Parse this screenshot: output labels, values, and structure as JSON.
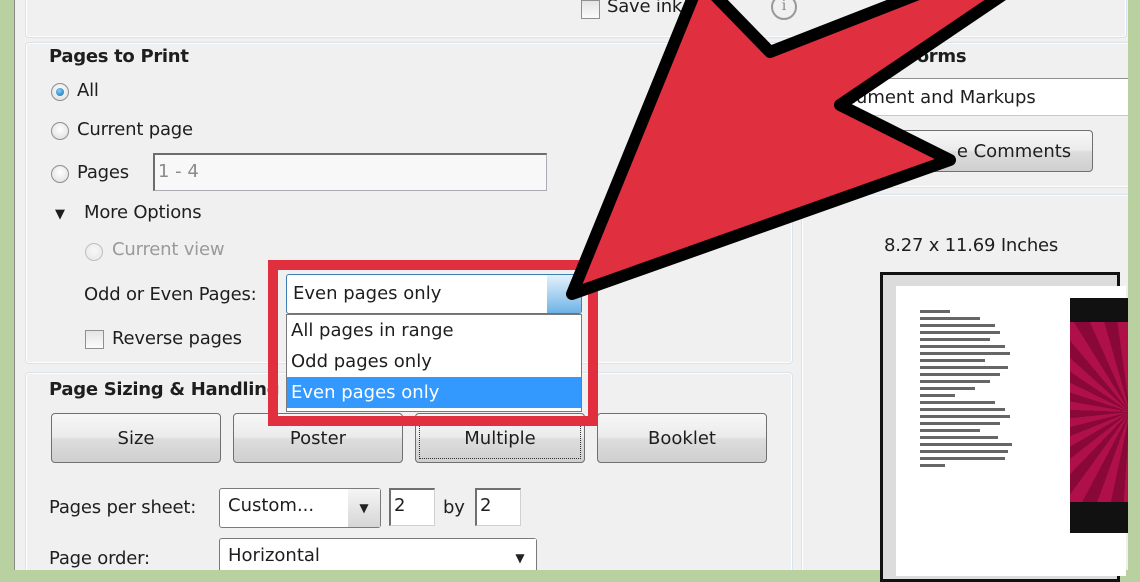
{
  "top": {
    "save_ink_label": "Save ink",
    "save_ink_checked": false,
    "info_icon": "info-icon"
  },
  "pages_to_print": {
    "title": "Pages to Print",
    "options": [
      {
        "label": "All",
        "selected": true
      },
      {
        "label": "Current page",
        "selected": false
      },
      {
        "label": "Pages",
        "selected": false
      }
    ],
    "pages_range_value": "1 - 4",
    "more_options_label": "More Options",
    "current_view_label": "Current view",
    "odd_even_label": "Odd or Even Pages:",
    "odd_even_selected": "Even pages only",
    "odd_even_options": [
      "All pages in range",
      "Odd pages only",
      "Even pages only"
    ],
    "odd_even_highlighted_index": 2,
    "reverse_pages_label": "Reverse pages",
    "reverse_pages_checked": false
  },
  "page_sizing": {
    "title": "Page Sizing & Handling",
    "buttons": [
      "Size",
      "Poster",
      "Multiple",
      "Booklet"
    ],
    "active_button": "Multiple",
    "pages_per_sheet_label": "Pages per sheet:",
    "pages_per_sheet_value": "Custom...",
    "cols_value": "2",
    "by_label": "by",
    "rows_value": "2",
    "page_order_label": "Page order:",
    "page_order_value": "Horizontal"
  },
  "comments_forms": {
    "title": "Comments & Forms",
    "title_visible": "ents & Forms",
    "select_value": "Document and Markups",
    "select_value_visible": "ocument and Markups",
    "summarize_button": "Summarize Comments",
    "summarize_button_visible": "e Comments"
  },
  "preview": {
    "size_label": "8.27 x 11.69 Inches"
  },
  "annotation": {
    "arrow_color": "#e02f3f",
    "box_color": "#e02f3f",
    "outline_color": "#000000"
  }
}
